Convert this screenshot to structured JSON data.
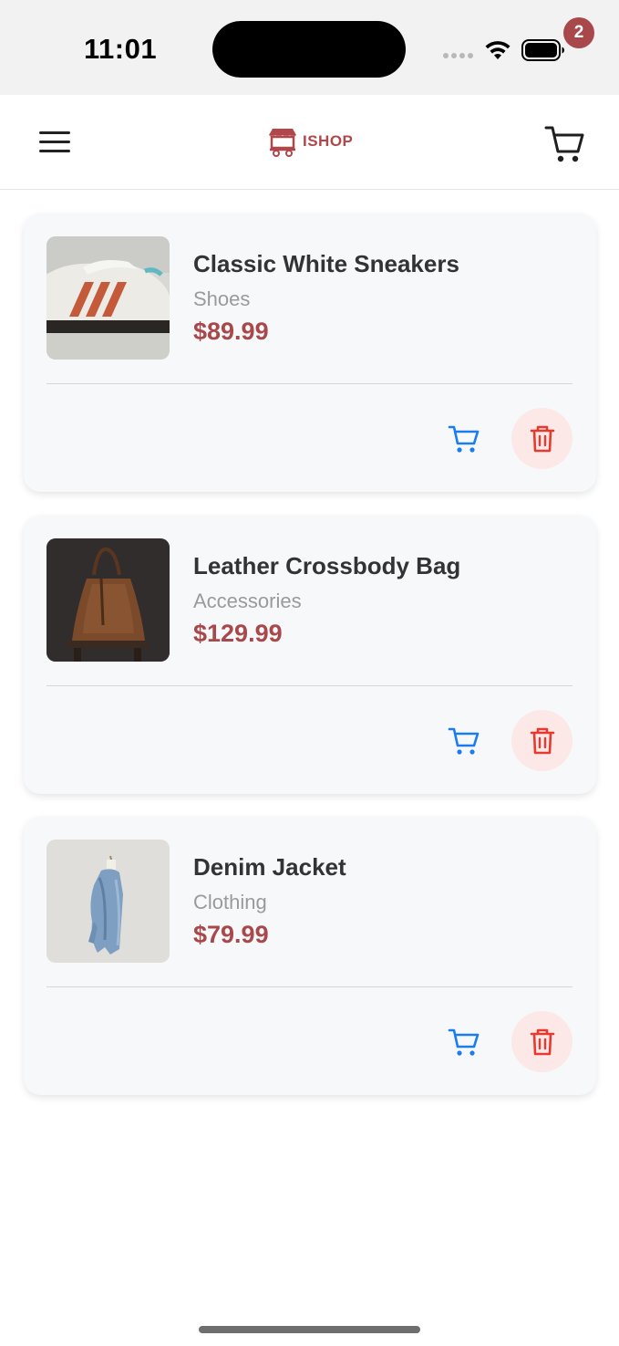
{
  "status_bar": {
    "time": "11:01"
  },
  "header": {
    "logo_text": "ISHOP",
    "cart_count": "2",
    "brand_color": "#a8484b"
  },
  "products": [
    {
      "name": "Classic White Sneakers",
      "category": "Shoes",
      "price": "$89.99",
      "image": "sneaker-photo"
    },
    {
      "name": "Leather Crossbody Bag",
      "category": "Accessories",
      "price": "$129.99",
      "image": "leather-bag-photo"
    },
    {
      "name": "Denim Jacket",
      "category": "Clothing",
      "price": "$79.99",
      "image": "denim-jacket-photo"
    }
  ],
  "colors": {
    "accent_blue": "#1a7cf0",
    "delete_red": "#e8392f",
    "delete_bg": "#fde8e8",
    "price": "#a8484b"
  }
}
